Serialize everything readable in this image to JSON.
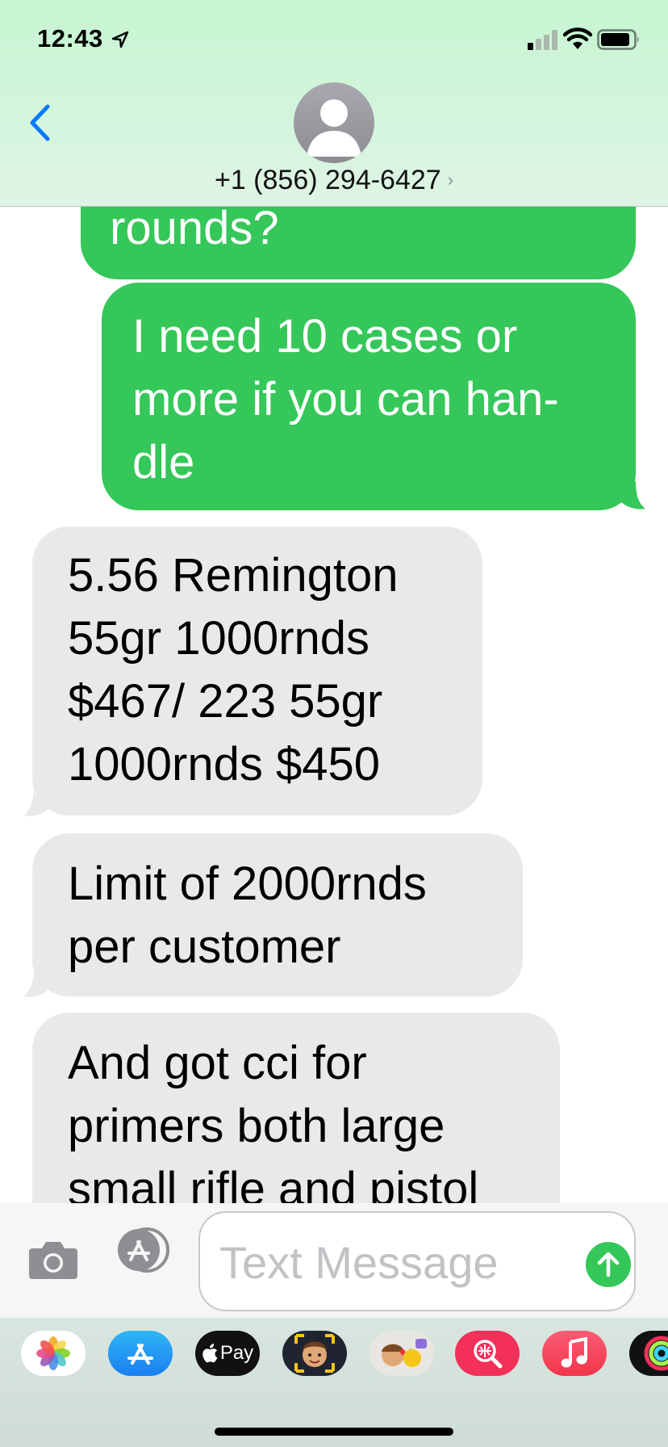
{
  "status_bar": {
    "time": "12:43"
  },
  "header": {
    "contact": "+1 (856) 294-6427",
    "chevron": "›"
  },
  "messages": [
    {
      "direction": "sent",
      "text": "rounds?"
    },
    {
      "direction": "sent",
      "lines": [
        "I need 10 cases or",
        "more if you can han-",
        "dle"
      ]
    },
    {
      "direction": "received",
      "lines": [
        "5.56 Remington",
        "55gr 1000rnds",
        "$467/ 223 55gr",
        "1000rnds $450"
      ]
    },
    {
      "direction": "received",
      "lines": [
        "Limit of 2000rnds",
        "per customer"
      ]
    },
    {
      "direction": "received",
      "lines": [
        "And got cci for",
        "primers both large",
        "small rifle and pistol"
      ]
    }
  ],
  "input": {
    "placeholder": "Text Message"
  },
  "app_drawer": {
    "apple_pay_label": "Pay",
    "apps": [
      "photos-icon",
      "app-store-icon",
      "apple-pay-icon",
      "memoji-icon",
      "animoji-icon",
      "image-search-icon",
      "music-icon",
      "activity-icon"
    ]
  },
  "colors": {
    "sent_bubble": "#35c759",
    "received_bubble": "#e9e9eb",
    "accent_blue": "#0a7aff"
  }
}
